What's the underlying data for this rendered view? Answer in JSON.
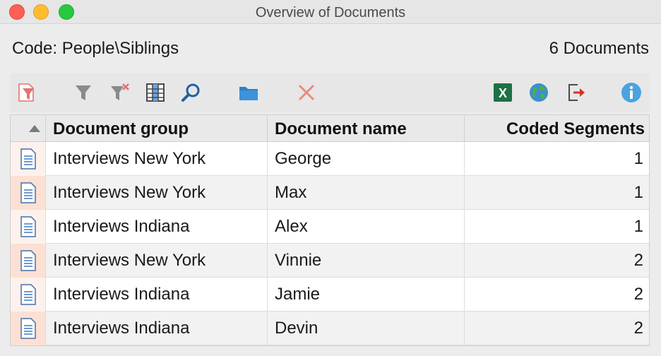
{
  "window": {
    "title": "Overview of Documents"
  },
  "info": {
    "code_label": "Code: People\\Siblings",
    "doc_count": "6 Documents"
  },
  "toolbar": {
    "items": [
      {
        "name": "filter-active-icon",
        "color": "#e57373"
      },
      {
        "name": "filter-icon",
        "color": "#8a8a8a"
      },
      {
        "name": "clear-filter-icon",
        "color": "#8a8a8a"
      },
      {
        "name": "columns-icon",
        "color": "#4a4a4a"
      },
      {
        "name": "search-icon",
        "color": "#1f5fa6"
      },
      {
        "name": "folder-icon",
        "color": "#2f7fc4"
      },
      {
        "name": "delete-icon",
        "color": "#ef8a80"
      },
      {
        "name": "excel-export-icon",
        "color": "#1e7145"
      },
      {
        "name": "web-export-icon",
        "color": "#3a8fd0"
      },
      {
        "name": "export-icon",
        "color": "#d93025"
      },
      {
        "name": "info-icon",
        "color": "#4aa3df"
      }
    ]
  },
  "table": {
    "headers": {
      "group": "Document group",
      "name": "Document name",
      "segments": "Coded Segments"
    },
    "rows": [
      {
        "group": "Interviews New York",
        "name": "George",
        "segments": "1"
      },
      {
        "group": "Interviews New York",
        "name": "Max",
        "segments": "1"
      },
      {
        "group": "Interviews Indiana",
        "name": "Alex",
        "segments": "1"
      },
      {
        "group": "Interviews New York",
        "name": "Vinnie",
        "segments": "2"
      },
      {
        "group": "Interviews Indiana",
        "name": "Jamie",
        "segments": "2"
      },
      {
        "group": "Interviews Indiana",
        "name": "Devin",
        "segments": "2"
      }
    ]
  }
}
